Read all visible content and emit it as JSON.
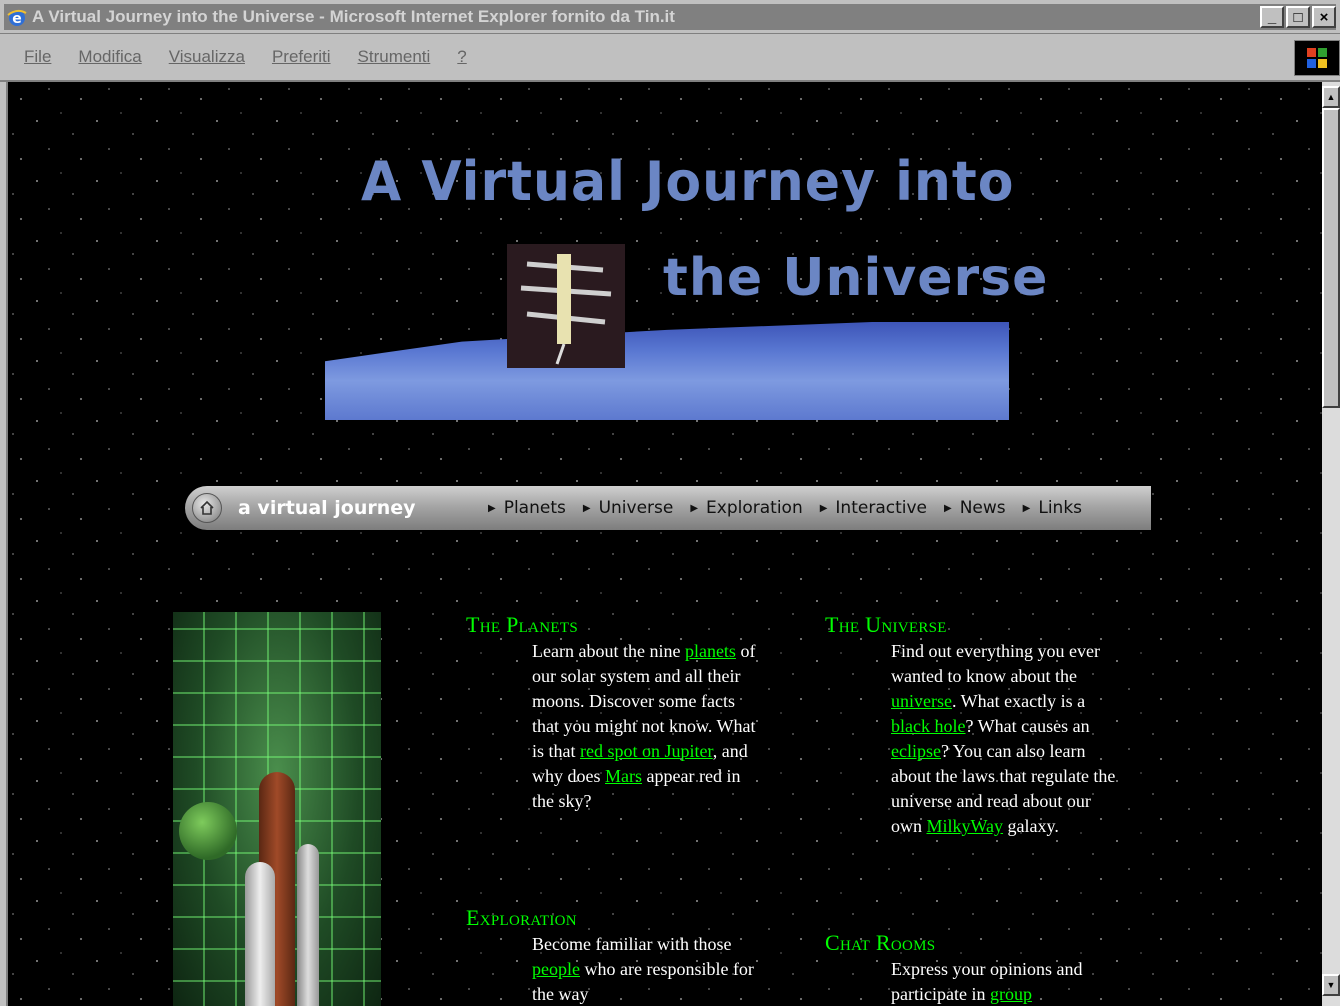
{
  "window": {
    "title": "A Virtual Journey into the Universe - Microsoft Internet Explorer fornito da Tin.it",
    "controls": [
      "_",
      "□",
      "×"
    ]
  },
  "menubar": {
    "items": [
      "File",
      "Modifica",
      "Visualizza",
      "Preferiti",
      "Strumenti",
      "?"
    ]
  },
  "banner": {
    "line1": "A Virtual Journey into",
    "line2": "the Universe"
  },
  "nav": {
    "brand": "a virtual journey",
    "links": [
      "Planets",
      "Universe",
      "Exploration",
      "Interactive",
      "News",
      "Links"
    ]
  },
  "sections": {
    "planets": {
      "title": "The Planets",
      "t1": "Learn about the nine",
      "link1": "planets",
      "t2": " of our solar system and all their moons. Discover some facts that you might not know. What is that ",
      "link2": "red spot on Jupiter",
      "t3": ", and why does ",
      "link3": "Mars",
      "t4": " appear red in the sky?"
    },
    "universe": {
      "title": "The Universe",
      "t1": "Find out everything you ever wanted to know about the ",
      "link1": "universe",
      "t2": ". What exactly is a ",
      "link2": "black hole",
      "t3": "? What causes an ",
      "link3": "eclipse",
      "t4": "? You can also learn about the laws that regulate the universe and read about our own ",
      "link4": "MilkyWay",
      "t5": " galaxy."
    },
    "exploration": {
      "title": "Exploration",
      "t1": "Become familiar with those ",
      "link1": "people",
      "t2": " who are responsible for the way"
    },
    "chat": {
      "title": "Chat Rooms",
      "t1": "Express your opinions and participate in ",
      "link1": "group"
    }
  },
  "colors": {
    "link_green": "#00ff00",
    "banner_blue": "#6b86c4",
    "chrome_gray": "#c0c0c0"
  }
}
